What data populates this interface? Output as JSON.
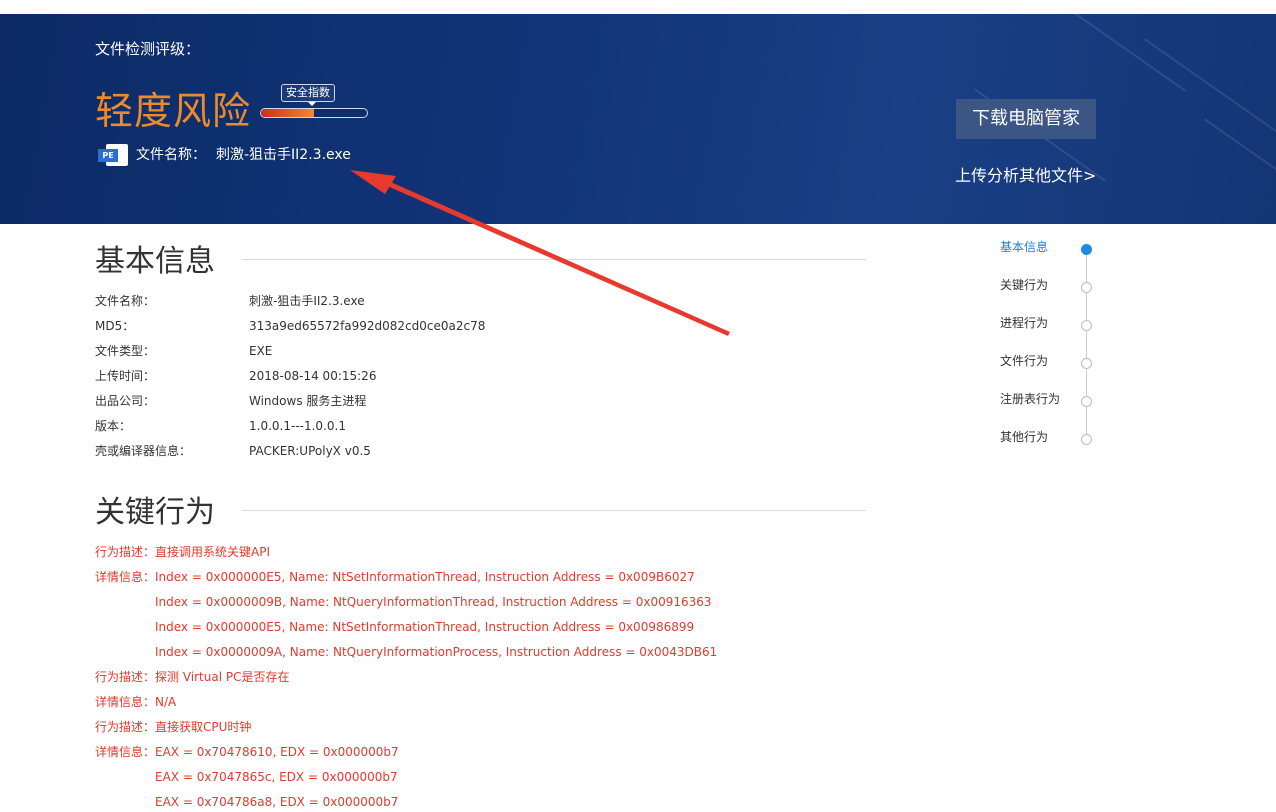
{
  "header": {
    "rating_label": "文件检测评级：",
    "risk_level": "轻度风险",
    "score_label": "安全指数",
    "score_fraction": 0.5,
    "file_icon_text": "PE",
    "file_name_label": "文件名称：",
    "file_name_value": "刺激-狙击手II2.3.exe",
    "download_button": "下载电脑管家",
    "upload_link": "上传分析其他文件>"
  },
  "basic": {
    "title": "基本信息",
    "rows": [
      {
        "key": "文件名称：",
        "value": "刺激-狙击手II2.3.exe"
      },
      {
        "key": "MD5：",
        "value": "313a9ed65572fa992d082cd0ce0a2c78"
      },
      {
        "key": "文件类型：",
        "value": "EXE"
      },
      {
        "key": "上传时间：",
        "value": "2018-08-14 00:15:26"
      },
      {
        "key": "出品公司：",
        "value": "Windows 服务主进程"
      },
      {
        "key": "版本：",
        "value": "1.0.0.1---1.0.0.1"
      },
      {
        "key": "壳或编译器信息：",
        "value": "PACKER:UPolyX v0.5"
      }
    ]
  },
  "behavior": {
    "title": "关键行为",
    "rows": [
      {
        "key": "行为描述：",
        "value": "直接调用系统关键API"
      },
      {
        "key": "详情信息：",
        "value": "Index = 0x000000E5, Name: NtSetInformationThread, Instruction Address = 0x009B6027"
      },
      {
        "key": "",
        "value": "Index = 0x0000009B, Name: NtQueryInformationThread, Instruction Address = 0x00916363"
      },
      {
        "key": "",
        "value": "Index = 0x000000E5, Name: NtSetInformationThread, Instruction Address = 0x00986899"
      },
      {
        "key": "",
        "value": "Index = 0x0000009A, Name: NtQueryInformationProcess, Instruction Address = 0x0043DB61"
      },
      {
        "key": "行为描述：",
        "value": "探测 Virtual PC是否存在"
      },
      {
        "key": "详情信息：",
        "value": "N/A"
      },
      {
        "key": "行为描述：",
        "value": "直接获取CPU时钟"
      },
      {
        "key": "详情信息：",
        "value": "EAX = 0x70478610, EDX = 0x000000b7"
      },
      {
        "key": "",
        "value": "EAX = 0x7047865c, EDX = 0x000000b7"
      },
      {
        "key": "",
        "value": "EAX = 0x704786a8, EDX = 0x000000b7"
      }
    ]
  },
  "nav": {
    "items": [
      "基本信息",
      "关键行为",
      "进程行为",
      "文件行为",
      "注册表行为",
      "其他行为"
    ],
    "active_index": 0
  },
  "colors": {
    "banner": "#12357a",
    "risk": "#ef8a2a",
    "detail_text": "#e03b2e",
    "nav_active": "#1f8ae0",
    "annotation_arrow": "#e8392f"
  }
}
